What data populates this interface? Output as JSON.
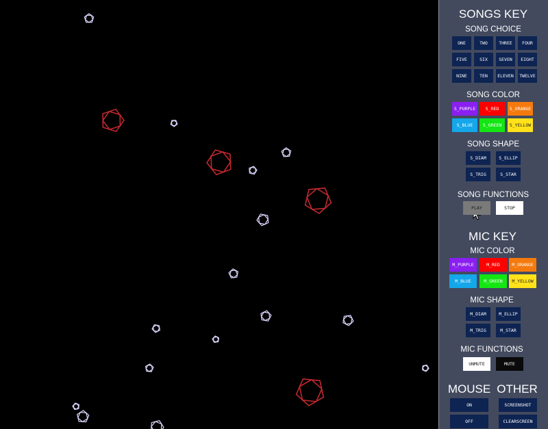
{
  "songs_key": {
    "title": "SONGS KEY",
    "choice_heading": "SONG CHOICE",
    "choices": [
      "ONE",
      "TWO",
      "THREE",
      "FOUR",
      "FIVE",
      "SIX",
      "SEVEN",
      "EIGHT",
      "NINE",
      "TEN",
      "ELEVEN",
      "TWELVE"
    ],
    "color_heading": "SONG COLOR",
    "colors": [
      {
        "label": "S_PURPLE",
        "bg": "#8a1ff0",
        "fg": "#ffffff"
      },
      {
        "label": "S_RED",
        "bg": "#ff0000",
        "fg": "#ffffff"
      },
      {
        "label": "S_ORANGE",
        "bg": "#f57a0e",
        "fg": "#ffffff"
      },
      {
        "label": "S_BLUE",
        "bg": "#14a7ea",
        "fg": "#ffffff"
      },
      {
        "label": "S_GREEN",
        "bg": "#14e614",
        "fg": "#ffffff"
      },
      {
        "label": "S_YELLOW",
        "bg": "#ffe21a",
        "fg": "#222222"
      }
    ],
    "shape_heading": "SONG SHAPE",
    "shapes": [
      "S_DIAM",
      "S_ELLIP",
      "S_TRIG",
      "S_STAR"
    ],
    "functions_heading": "SONG FUNCTIONS",
    "play_label": "PLAY",
    "stop_label": "STOP"
  },
  "mic_key": {
    "title": "MIC KEY",
    "color_heading": "MIC COLOR",
    "colors": [
      {
        "label": "M_PURPLE",
        "bg": "#8a1ff0",
        "fg": "#ffffff"
      },
      {
        "label": "M_RED",
        "bg": "#ff0000",
        "fg": "#ffffff"
      },
      {
        "label": "M_ORANGE",
        "bg": "#f57a0e",
        "fg": "#ffffff"
      },
      {
        "label": "M_BLUE",
        "bg": "#14a7ea",
        "fg": "#ffffff"
      },
      {
        "label": "M_GREEN",
        "bg": "#14e614",
        "fg": "#ffffff"
      },
      {
        "label": "M_YELLOW",
        "bg": "#ffe21a",
        "fg": "#222222"
      }
    ],
    "shape_heading": "MIC SHAPE",
    "shapes": [
      "M_DIAM",
      "M_ELLIP",
      "M_TRIG",
      "M_STAR"
    ],
    "functions_heading": "MIC FUNCTIONS",
    "unmute_label": "UNMUTE",
    "mute_label": "MUTE"
  },
  "mouse": {
    "title": "MOUSE",
    "on_label": "ON",
    "off_label": "OFF"
  },
  "other": {
    "title": "OTHER",
    "screenshot_label": "SCREENSHOT",
    "clearscreen_label": "CLEARSCREEN"
  },
  "colors": {
    "panel_bg": "#434a5e",
    "button_bg": "#0e2452",
    "play_active_bg": "#7a7a7a",
    "white_button_bg": "#ffffff",
    "black_button_bg": "#0a0a0a",
    "large_shape_stroke": "#c0282e",
    "small_shape_stroke": "#e2d8ff"
  }
}
